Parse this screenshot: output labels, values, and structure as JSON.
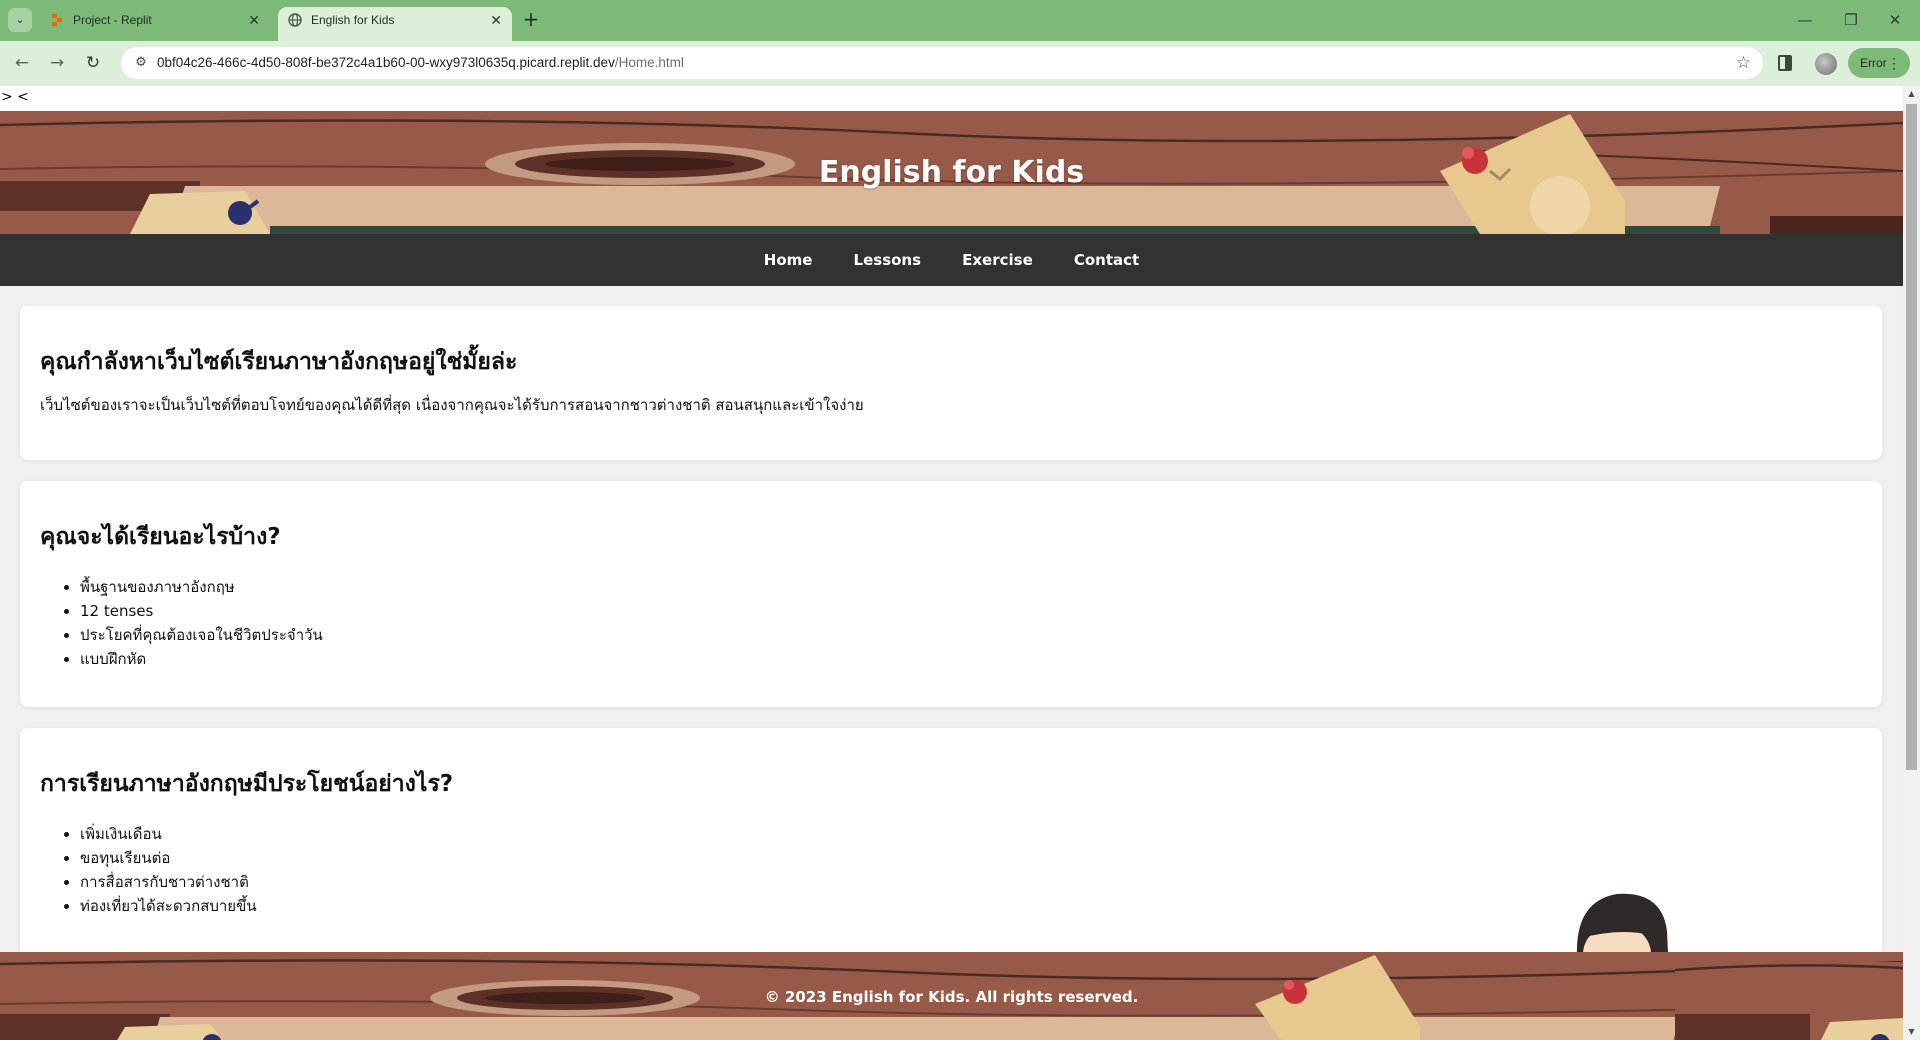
{
  "browser": {
    "tabs": [
      {
        "title": "Project - Replit",
        "active": false,
        "icon": "replit-icon"
      },
      {
        "title": "English for Kids",
        "active": true,
        "icon": "globe-icon"
      }
    ],
    "url_host": "0bf04c26-466c-4d50-808f-be372c4a1b60-00-wxy973l0635q.picard.replit.dev",
    "url_path": "/Home.html",
    "error_label": "Error",
    "colors": {
      "frame": "#7dba7a",
      "toolbar": "#dcefd9"
    }
  },
  "page": {
    "stray_text": "> <",
    "site_title": "English for Kids",
    "nav": [
      "Home",
      "Lessons",
      "Exercise",
      "Contact"
    ],
    "sections": [
      {
        "heading": "คุณกำลังหาเว็บไซต์เรียนภาษาอังกฤษอยู่ใช่มั้ยล่ะ",
        "text": "เว็บไซต์ของเราจะเป็นเว็บไซต์ที่ตอบโจทย์ของคุณได้ดีที่สุด เนื่องจากคุณจะได้รับการสอนจากชาวต่างชาติ สอนสนุกและเข้าใจง่าย"
      },
      {
        "heading": "คุณจะได้เรียนอะไรบ้าง?",
        "items": [
          "พื้นฐานของภาษาอังกฤษ",
          "12 tenses",
          "ประโยคที่คุณต้องเจอในชีวิตประจำวัน",
          "แบบฝึกหัด"
        ]
      },
      {
        "heading": "การเรียนภาษาอังกฤษมีประโยชน์อย่างไร?",
        "items": [
          "เพิ่มเงินเดือน",
          "ขอทุนเรียนต่อ",
          "การสื่อสารกับชาวต่างชาติ",
          "ท่องเที่ยวได้สะดวกสบายขึ้น"
        ]
      }
    ],
    "footer": "© 2023 English for Kids. All rights reserved.",
    "colors": {
      "banner": "#975a48",
      "nav_bg": "#323232",
      "page_bg": "#f0f0f0",
      "card_bg": "#ffffff"
    }
  }
}
